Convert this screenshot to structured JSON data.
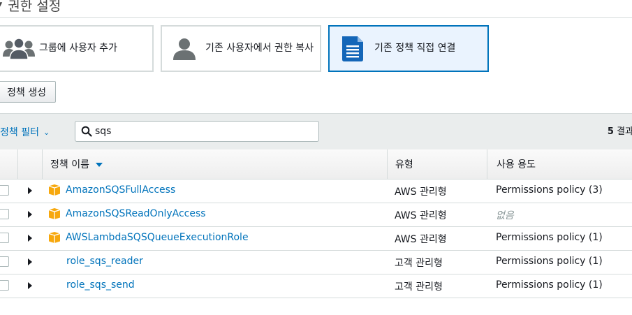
{
  "section": {
    "title": "권한 설정"
  },
  "options": [
    {
      "label": "그룹에 사용자 추가",
      "icon": "users-group-icon"
    },
    {
      "label": "기존 사용자에서 권한 복사",
      "icon": "user-icon"
    },
    {
      "label": "기존 정책 직접 연결",
      "icon": "document-icon",
      "selected": true
    }
  ],
  "create_policy_label": "정책 생성",
  "filter": {
    "label": "정책 필터",
    "search_value": "sqs",
    "result_count": "5",
    "result_suffix": "결과"
  },
  "table": {
    "columns": [
      "정책 이름",
      "유형",
      "사용 용도"
    ],
    "rows": [
      {
        "name": "AmazonSQSFullAccess",
        "type": "AWS 관리형",
        "usage": "Permissions policy (3)",
        "managed": true
      },
      {
        "name": "AmazonSQSReadOnlyAccess",
        "type": "AWS 관리형",
        "usage": "없음",
        "managed": true
      },
      {
        "name": "AWSLambdaSQSQueueExecutionRole",
        "type": "AWS 관리형",
        "usage": "Permissions policy (1)",
        "managed": true
      },
      {
        "name": "role_sqs_reader",
        "type": "고객 관리형",
        "usage": "Permissions policy (1)",
        "managed": false
      },
      {
        "name": "role_sqs_send",
        "type": "고객 관리형",
        "usage": "Permissions policy (1)",
        "managed": false
      }
    ]
  },
  "colors": {
    "accent": "#0073bb",
    "aws_package": "#f7a80d"
  }
}
